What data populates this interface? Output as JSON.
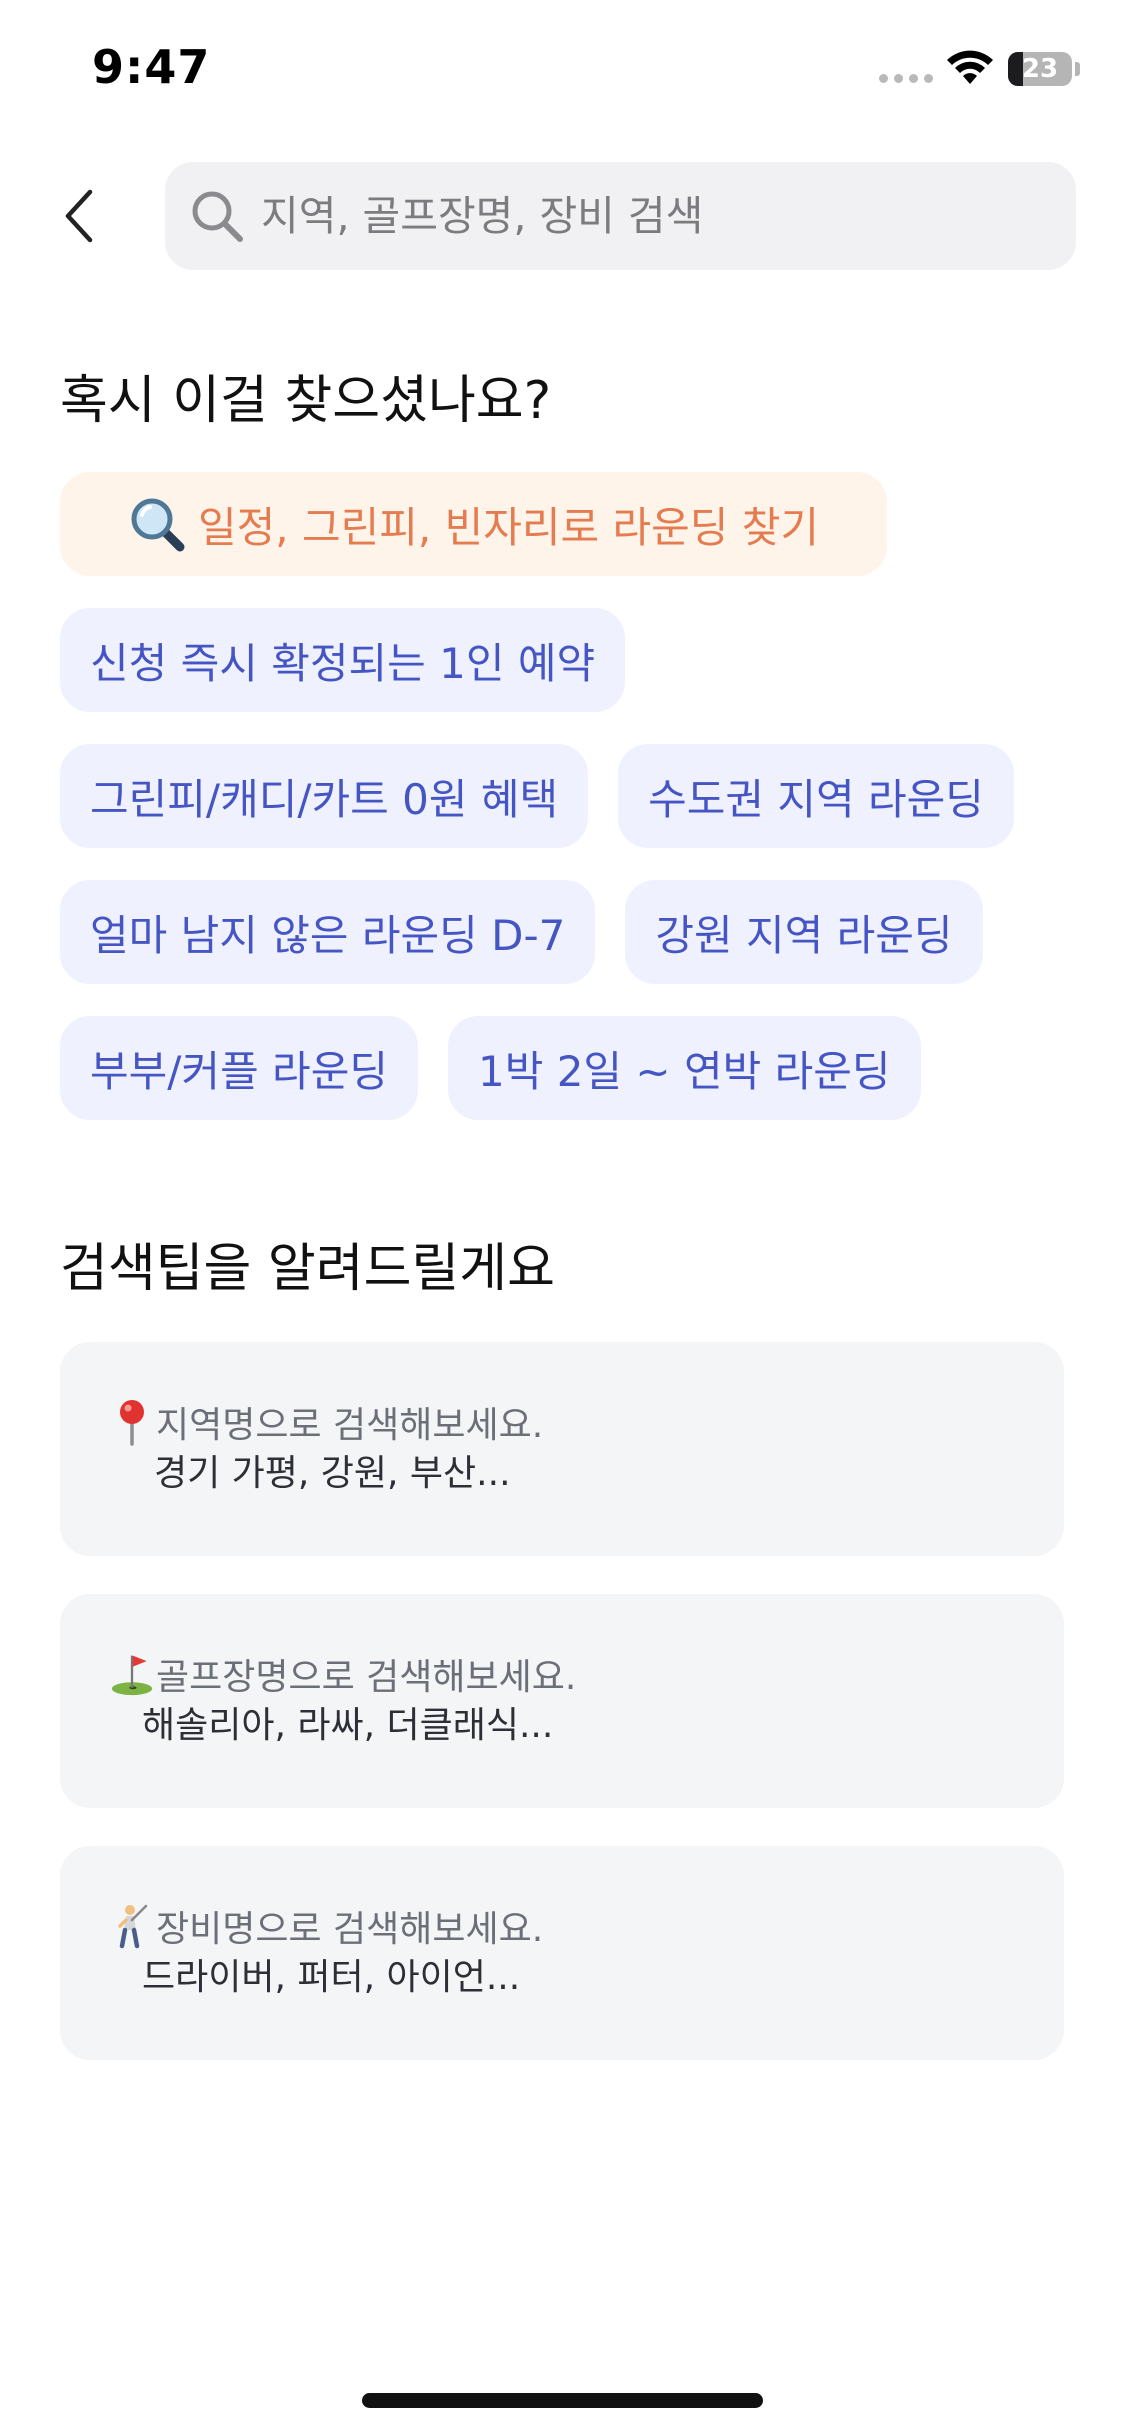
{
  "status_bar": {
    "time": "9:47",
    "battery_level": "23",
    "battery_fraction": 0.23
  },
  "search": {
    "placeholder": "지역, 골프장명, 장비 검색",
    "value": ""
  },
  "suggestions": {
    "title": "혹시 이걸 찾으셨나요?",
    "featured_chip": "일정, 그린피, 빈자리로 라운딩 찾기",
    "chips": [
      "신청 즉시 확정되는 1인 예약",
      "그린피/캐디/카트 0원 혜택",
      "수도권 지역 라운딩",
      "얼마 남지 않은 라운딩 D-7",
      "강원 지역 라운딩",
      "부부/커플 라운딩",
      "1박 2일 ~ 연박 라운딩"
    ]
  },
  "tips": {
    "title": "검색팁을 알려드릴게요",
    "items": [
      {
        "icon": "round-pushpin-icon",
        "heading": "지역명으로 검색해보세요.",
        "examples": "경기 가평, 강원, 부산..."
      },
      {
        "icon": "golf-flag-icon",
        "heading": "골프장명으로 검색해보세요.",
        "examples": "해솔리아, 라싸, 더클래식..."
      },
      {
        "icon": "golfer-icon",
        "heading": "장비명으로 검색해보세요.",
        "examples": "드라이버, 퍼터, 아이언..."
      }
    ]
  },
  "colors": {
    "chip_bg": "#eff2fe",
    "chip_text": "#4556c4",
    "featured_bg": "#fff4ea",
    "featured_text": "#e57c50",
    "tip_bg": "#f4f5f7"
  }
}
